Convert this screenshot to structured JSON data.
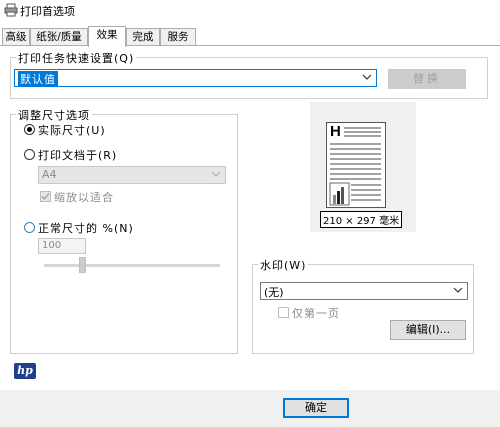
{
  "window": {
    "title": "打印首选项"
  },
  "tabs": [
    {
      "label": "高级"
    },
    {
      "label": "纸张/质量"
    },
    {
      "label": "效果"
    },
    {
      "label": "完成"
    },
    {
      "label": "服务"
    }
  ],
  "quick_settings": {
    "group_title": "打印任务快速设置(Q)",
    "selected_value": "默认值",
    "replace_label": "替换"
  },
  "resize": {
    "group_title": "调整尺寸选项",
    "actual_size_label": "实际尺寸(U)",
    "fit_to_label": "打印文档于(R)",
    "fit_to_value": "A4",
    "scale_to_fit_label": "缩放以适合",
    "percent_label": "正常尺寸的 %(N)",
    "percent_value": "100",
    "slider_level_percent": 10
  },
  "preview": {
    "header_letter": "H",
    "size_text": "210 × 297 毫米"
  },
  "watermark": {
    "group_title": "水印(W)",
    "selected_value": "(无)",
    "first_page_only_label": "仅第一页",
    "edit_label": "编辑(I)..."
  },
  "footer": {
    "brand": "hp",
    "ok_label": "确定"
  },
  "icons": {
    "printer": "printer-icon",
    "dropdown": "chevron-down-icon"
  }
}
